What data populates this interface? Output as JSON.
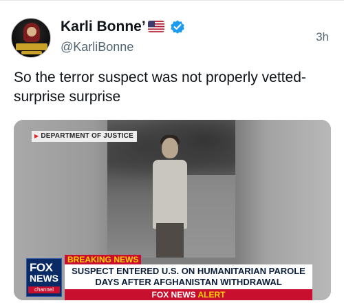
{
  "post": {
    "author_name": "Karli Bonne’",
    "handle": "@KarliBonne",
    "time": "3h",
    "text": "So the terror suspect was not properly vetted- surprise surprise"
  },
  "media": {
    "source_tag": "DEPARTMENT OF JUSTICE",
    "breaking_label": "BREAKING NEWS",
    "headline_line1": "SUSPECT ENTERED U.S. ON HUMANITARIAN PAROLE",
    "headline_line2": "DAYS AFTER AFGHANISTAN WITHDRAWAL",
    "alert_prefix": "FOX NEWS",
    "alert_word": "ALERT",
    "logo_fox": "FOX",
    "logo_news": "NEWS",
    "logo_channel": "channel"
  },
  "colors": {
    "verified": "#1d9bf0",
    "fox_red": "#c8102e",
    "fox_blue": "#0a2a66"
  },
  "icons": {
    "flag": "us-flag-icon",
    "verified": "verified-badge-icon"
  }
}
